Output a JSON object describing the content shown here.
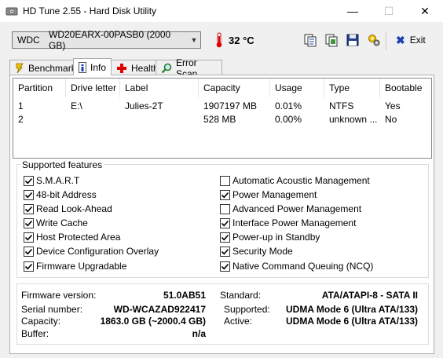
{
  "window": {
    "title": "HD Tune 2.55 - Hard Disk Utility",
    "minimize": "—",
    "maximize": "☐",
    "close": "✕"
  },
  "toolbar": {
    "drive_vendor": "WDC",
    "drive_model": "WD20EARX-00PASB0 (2000 GB)",
    "temperature": "32 °C",
    "exit_label": "Exit",
    "icons": [
      "copy-text-icon",
      "copy-screenshot-icon",
      "save-icon",
      "options-icon"
    ]
  },
  "tabs": [
    {
      "label": "Benchmark",
      "icon": "benchmark-icon"
    },
    {
      "label": "Info",
      "icon": "info-icon"
    },
    {
      "label": "Health",
      "icon": "health-icon"
    },
    {
      "label": "Error Scan",
      "icon": "search-icon"
    }
  ],
  "active_tab": "Info",
  "partitions": {
    "columns": [
      "Partition",
      "Drive letter",
      "Label",
      "Capacity",
      "Usage",
      "Type",
      "Bootable"
    ],
    "rows": [
      [
        "1",
        "E:\\",
        "Julies-2T",
        "1907197 MB",
        "0.01%",
        "NTFS",
        "Yes"
      ],
      [
        "2",
        "",
        "",
        "528 MB",
        "0.00%",
        "unknown ...",
        "No"
      ]
    ]
  },
  "features": {
    "title": "Supported features",
    "left": [
      {
        "label": "S.M.A.R.T",
        "checked": true
      },
      {
        "label": "48-bit Address",
        "checked": true
      },
      {
        "label": "Read Look-Ahead",
        "checked": true
      },
      {
        "label": "Write Cache",
        "checked": true
      },
      {
        "label": "Host Protected Area",
        "checked": true
      },
      {
        "label": "Device Configuration Overlay",
        "checked": true
      },
      {
        "label": "Firmware Upgradable",
        "checked": true
      }
    ],
    "right": [
      {
        "label": "Automatic Acoustic Management",
        "checked": false
      },
      {
        "label": "Power Management",
        "checked": true
      },
      {
        "label": "Advanced Power Management",
        "checked": false
      },
      {
        "label": "Interface Power Management",
        "checked": true
      },
      {
        "label": "Power-up in Standby",
        "checked": true
      },
      {
        "label": "Security Mode",
        "checked": true
      },
      {
        "label": "Native Command Queuing (NCQ)",
        "checked": true
      }
    ]
  },
  "info": {
    "firmware_label": "Firmware version:",
    "firmware_value": "51.0AB51",
    "serial_label": "Serial number:",
    "serial_value": "WD-WCAZAD922417",
    "capacity_label": "Capacity:",
    "capacity_value": "1863.0 GB (~2000.4 GB)",
    "buffer_label": "Buffer:",
    "buffer_value": "n/a",
    "standard_label": "Standard:",
    "standard_value": "ATA/ATAPI-8 - SATA II",
    "supported_label": "Supported:",
    "supported_value": "UDMA Mode 6 (Ultra ATA/133)",
    "active_label": "Active:",
    "active_value": "UDMA Mode 6 (Ultra ATA/133)"
  }
}
